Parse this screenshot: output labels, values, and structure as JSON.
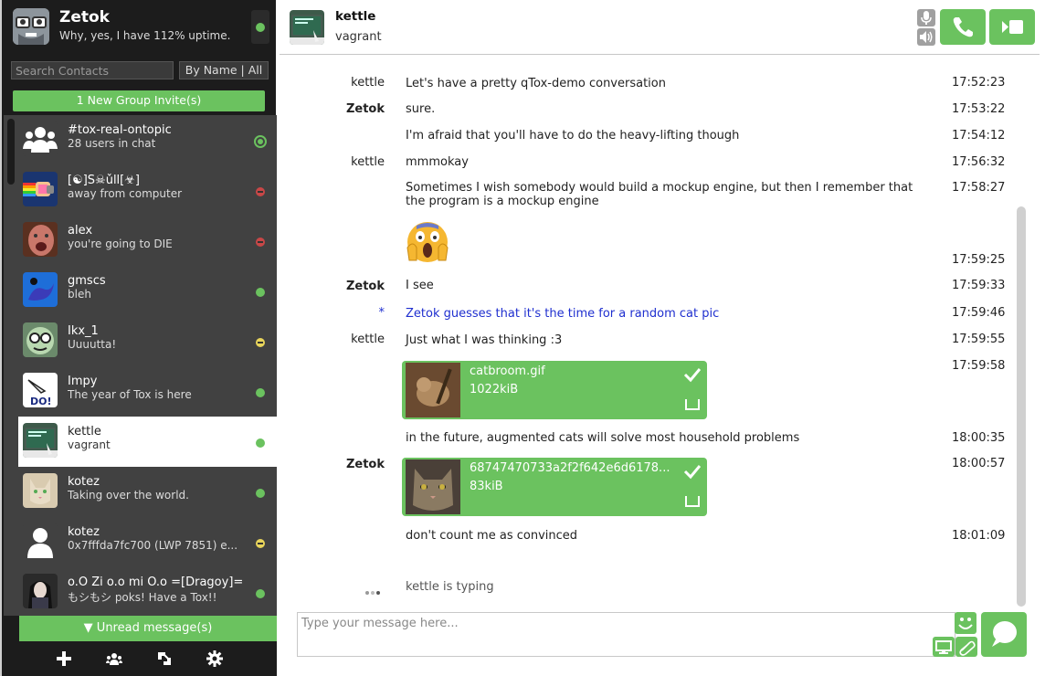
{
  "colors": {
    "accent": "#6bc25f",
    "sidebar": "#1c1c1c",
    "contacts_bg": "#414141",
    "busy": "#c84747",
    "away": "#e8d45b",
    "action": "#1f2fcf"
  },
  "self": {
    "name": "Zetok",
    "status_message": "Why, yes, I have 112% uptime.",
    "status": "online"
  },
  "search": {
    "placeholder": "Search Contacts",
    "sort_label": "By Name | All"
  },
  "group_invite": "1 New Group Invite(s)",
  "contacts": [
    {
      "name": "#tox-real-ontopic",
      "status": "28 users in chat",
      "presence": "group",
      "icon": "group-icon"
    },
    {
      "name": "[☯]S☠ǔll[☣]",
      "status": "away from computer",
      "presence": "busy"
    },
    {
      "name": "alex",
      "status": "you're going to DIE",
      "presence": "busy"
    },
    {
      "name": "gmscs",
      "status": "bleh",
      "presence": "online"
    },
    {
      "name": "Ikx_1",
      "status": "Uuuutta!",
      "presence": "away"
    },
    {
      "name": "Impy",
      "status": "The year of Tox is here",
      "presence": "online"
    },
    {
      "name": "kettle",
      "status": "vagrant",
      "presence": "online",
      "active": true
    },
    {
      "name": "kotez",
      "status": "Taking over the world.",
      "presence": "online"
    },
    {
      "name": "kotez",
      "status": "0x7fffda7fc700 (LWP 7851) e...",
      "presence": "away"
    },
    {
      "name": "o.O Zi o.o mi O.o =[Dragoy]=",
      "status": "もシもシ poks!  Have a Tox!!",
      "presence": "online"
    }
  ],
  "unread": "▼ Unread message(s)",
  "bottom_bar": [
    "add-icon",
    "groups-icon",
    "transfers-icon",
    "settings-icon"
  ],
  "chat": {
    "peer_name": "kettle",
    "peer_status": "vagrant",
    "input_placeholder": "Type your message here...",
    "messages": [
      {
        "author": "kettle",
        "text": "Let's have a pretty qTox-demo conversation",
        "time": "17:52:23"
      },
      {
        "author": "Zetok",
        "text": "sure.",
        "time": "17:53:22"
      },
      {
        "author": "",
        "text": "I'm afraid that you'll have to do the heavy-lifting though",
        "time": "17:54:12"
      },
      {
        "author": "kettle",
        "text": "mmmokay",
        "time": "17:56:32"
      },
      {
        "author": "",
        "text": "Sometimes I wish somebody would build a mockup engine, but then I remember that the program is a mockup engine",
        "time": "17:58:27"
      },
      {
        "author": "",
        "text": "",
        "emoji": "face-screaming-emoji",
        "time": "17:59:25"
      },
      {
        "author": "Zetok",
        "text": "I see",
        "time": "17:59:33"
      },
      {
        "author": "*",
        "text": "Zetok guesses that it's the time for a random cat pic",
        "time": "17:59:46",
        "action": true
      },
      {
        "author": "kettle",
        "text": "Just what I was thinking :3",
        "time": "17:59:55"
      },
      {
        "author": "",
        "file": {
          "name": "catbroom.gif",
          "size": "1022kiB"
        },
        "time": "17:59:58"
      },
      {
        "author": "",
        "text": "in the future, augmented cats will solve most household problems",
        "time": "18:00:35"
      },
      {
        "author": "Zetok",
        "file": {
          "name": "68747470733a2f2f642e6d6178...",
          "size": "83kiB"
        },
        "time": "18:00:57"
      },
      {
        "author": "",
        "text": "don't count me as convinced",
        "time": "18:01:09"
      }
    ],
    "typing": "kettle is typing"
  }
}
